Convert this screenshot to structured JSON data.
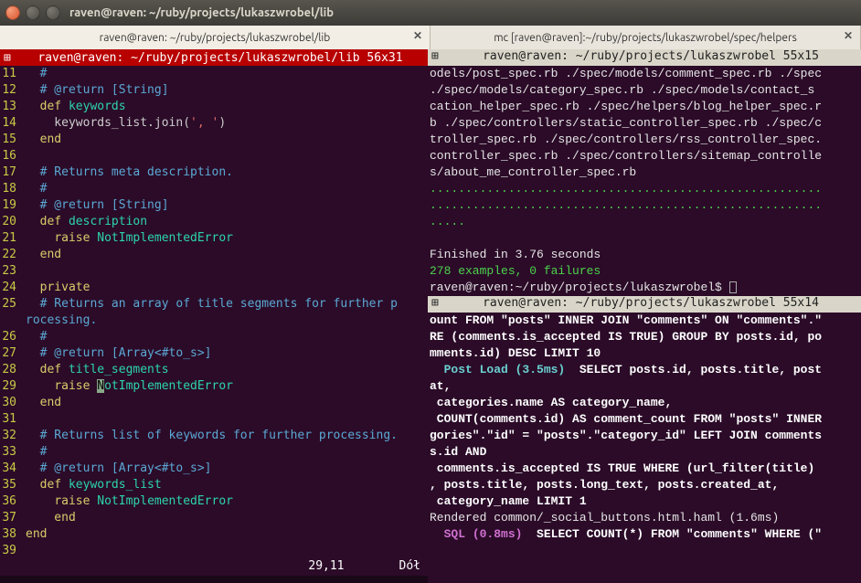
{
  "window": {
    "title": "raven@raven: ~/ruby/projects/lukaszwrobel/lib"
  },
  "tabs": [
    {
      "label": "raven@raven: ~/ruby/projects/lukaszwrobel/lib",
      "active": true
    },
    {
      "label": "mc [raven@raven]:~/ruby/projects/lukaszwrobel/spec/helpers",
      "active": false
    }
  ],
  "left": {
    "title": "raven@raven: ~/ruby/projects/lukaszwrobel/lib 56x31",
    "status_pos": "29,11",
    "status_end": "Dół",
    "lines": [
      {
        "n": "11",
        "segs": [
          {
            "t": "#",
            "c": "c-comment"
          }
        ]
      },
      {
        "n": "12",
        "segs": [
          {
            "t": "# @return [String]",
            "c": "c-comment"
          }
        ]
      },
      {
        "n": "13",
        "segs": [
          {
            "t": "def ",
            "c": "c-def"
          },
          {
            "t": "keywords",
            "c": "c-ident"
          }
        ]
      },
      {
        "n": "14",
        "segs": [
          {
            "t": "  keywords_list.join(",
            "c": ""
          },
          {
            "t": "', '",
            "c": "c-string"
          },
          {
            "t": ")",
            "c": ""
          }
        ]
      },
      {
        "n": "15",
        "segs": [
          {
            "t": "end",
            "c": "c-end"
          }
        ]
      },
      {
        "n": "16",
        "segs": []
      },
      {
        "n": "17",
        "segs": [
          {
            "t": "# Returns meta description.",
            "c": "c-comment"
          }
        ]
      },
      {
        "n": "18",
        "segs": [
          {
            "t": "#",
            "c": "c-comment"
          }
        ]
      },
      {
        "n": "19",
        "segs": [
          {
            "t": "# @return [String]",
            "c": "c-comment"
          }
        ]
      },
      {
        "n": "20",
        "segs": [
          {
            "t": "def ",
            "c": "c-def"
          },
          {
            "t": "description",
            "c": "c-ident"
          }
        ]
      },
      {
        "n": "21",
        "segs": [
          {
            "t": "  ",
            "c": ""
          },
          {
            "t": "raise ",
            "c": "c-raise"
          },
          {
            "t": "NotImplementedError",
            "c": "c-const"
          }
        ]
      },
      {
        "n": "22",
        "segs": [
          {
            "t": "end",
            "c": "c-end"
          }
        ]
      },
      {
        "n": "23",
        "segs": []
      },
      {
        "n": "24",
        "segs": [
          {
            "t": "private",
            "c": "c-private"
          }
        ]
      },
      {
        "n": "25",
        "segs": [
          {
            "t": "# Returns an array of title segments for further p",
            "c": "c-comment"
          }
        ]
      },
      {
        "n": "",
        "segs": [
          {
            "t": "rocessing.",
            "c": "c-comment"
          }
        ],
        "nolineno": true
      },
      {
        "n": "26",
        "segs": [
          {
            "t": "#",
            "c": "c-comment"
          }
        ]
      },
      {
        "n": "27",
        "segs": [
          {
            "t": "# @return [Array<#to_s>]",
            "c": "c-comment"
          }
        ]
      },
      {
        "n": "28",
        "segs": [
          {
            "t": "def ",
            "c": "c-def"
          },
          {
            "t": "title_segments",
            "c": "c-ident"
          }
        ]
      },
      {
        "n": "29",
        "segs": [
          {
            "t": "  ",
            "c": ""
          },
          {
            "t": "raise ",
            "c": "c-raise"
          },
          {
            "t": "N",
            "c": "cursor"
          },
          {
            "t": "otImplementedError",
            "c": "c-const"
          }
        ]
      },
      {
        "n": "30",
        "segs": [
          {
            "t": "end",
            "c": "c-end"
          }
        ]
      },
      {
        "n": "31",
        "segs": []
      },
      {
        "n": "32",
        "segs": [
          {
            "t": "# Returns list of keywords for further processing.",
            "c": "c-comment"
          }
        ]
      },
      {
        "n": "33",
        "segs": [
          {
            "t": "#",
            "c": "c-comment"
          }
        ]
      },
      {
        "n": "34",
        "segs": [
          {
            "t": "# @return [Array<#to_s>]",
            "c": "c-comment"
          }
        ]
      },
      {
        "n": "35",
        "segs": [
          {
            "t": "def ",
            "c": "c-def"
          },
          {
            "t": "keywords_list",
            "c": "c-ident"
          }
        ]
      },
      {
        "n": "36",
        "segs": [
          {
            "t": "  ",
            "c": ""
          },
          {
            "t": "raise ",
            "c": "c-raise"
          },
          {
            "t": "NotImplementedError",
            "c": "c-const"
          }
        ]
      },
      {
        "n": "37",
        "segs": [
          {
            "t": "  end",
            "c": "c-end"
          }
        ]
      },
      {
        "n": "38",
        "segs": [
          {
            "t": "end",
            "c": "c-end"
          }
        ],
        "outdent": true
      },
      {
        "n": "39",
        "segs": []
      }
    ]
  },
  "rightTop": {
    "title": "raven@raven: ~/ruby/projects/lukaszwrobel 55x15",
    "body_lines": [
      "odels/post_spec.rb ./spec/models/comment_spec.rb ./spec",
      "./spec/models/category_spec.rb ./spec/models/contact_s",
      "cation_helper_spec.rb ./spec/helpers/blog_helper_spec.r",
      "b ./spec/controllers/static_controller_spec.rb ./spec/c",
      "troller_spec.rb ./spec/controllers/rss_controller_spec.",
      "controller_spec.rb ./spec/controllers/sitemap_controlle",
      "s/about_me_controller_spec.rb"
    ],
    "dots": [
      ".......................................................",
      ".......................................................",
      "....."
    ],
    "finished": "Finished in 3.76 seconds",
    "summary": "278 examples, 0 failures",
    "prompt": "raven@raven:~/ruby/projects/lukaszwrobel$ "
  },
  "rightBottom": {
    "title": "raven@raven: ~/ruby/projects/lukaszwrobel 55x14",
    "lines": [
      {
        "pre": "",
        "bold": "ount FROM \"posts\" INNER JOIN \"comments\" ON \"comments\".\"",
        "post": ""
      },
      {
        "pre": "",
        "bold": "RE (comments.is_accepted IS TRUE) GROUP BY posts.id, po",
        "post": ""
      },
      {
        "pre": "",
        "bold": "mments.id) DESC LIMIT 10",
        "post": ""
      },
      {
        "pre": "  ",
        "colored": "Post Load (3.5ms)",
        "cc": "rb-cyan",
        "bold": "  SELECT posts.id, posts.title, post",
        "post": ""
      },
      {
        "pre": "",
        "bold": "at,",
        "post": ""
      },
      {
        "pre": "",
        "bold": " categories.name AS category_name,",
        "post": ""
      },
      {
        "pre": "",
        "bold": " COUNT(comments.id) AS comment_count FROM \"posts\" INNER",
        "post": ""
      },
      {
        "pre": "",
        "bold": "gories\".\"id\" = \"posts\".\"category_id\" LEFT JOIN comments",
        "post": ""
      },
      {
        "pre": "",
        "bold": "s.id AND",
        "post": ""
      },
      {
        "pre": "",
        "bold": " comments.is_accepted IS TRUE WHERE (url_filter(title)",
        "post": ""
      },
      {
        "pre": "",
        "bold": ", posts.title, posts.long_text, posts.created_at,",
        "post": ""
      },
      {
        "pre": "",
        "bold": " category_name LIMIT 1",
        "post": ""
      },
      {
        "pre": "",
        "plain": "Rendered common/_social_buttons.html.haml (1.6ms)",
        "post": ""
      },
      {
        "pre": "  ",
        "colored": "SQL (0.8ms)",
        "cc": "rb-magenta",
        "bold": "  SELECT COUNT(*) FROM \"comments\" WHERE (\"",
        "post": ""
      }
    ]
  }
}
